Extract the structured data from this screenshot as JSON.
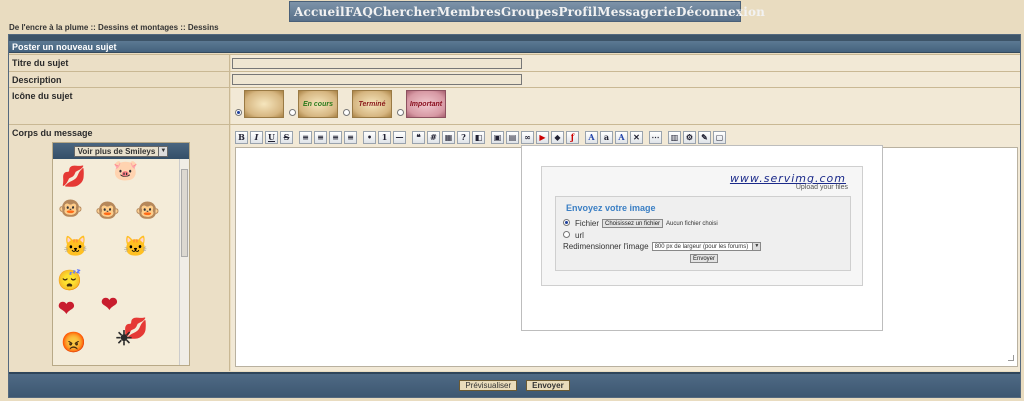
{
  "nav": [
    "Accueil",
    "FAQ",
    "Chercher",
    "Membres",
    "Groupes",
    "Profil",
    "Messagerie",
    "Déconnexion"
  ],
  "breadcrumb": "De l'encre à la plume  :: Dessins et montages :: Dessins",
  "form": {
    "header": "Poster un nouveau sujet",
    "title_label": "Titre du sujet",
    "description_label": "Description",
    "icon_label": "Icône du sujet",
    "body_label": "Corps du message"
  },
  "topic_icons": [
    {
      "label": "",
      "selected": true,
      "style": "parchment"
    },
    {
      "label": "En cours",
      "selected": false,
      "style": "parchment",
      "color": "#2b7a1c"
    },
    {
      "label": "Terminé",
      "selected": false,
      "style": "parchment",
      "color": "#8a1b1b"
    },
    {
      "label": "Important",
      "selected": false,
      "style": "pink",
      "color": "#8a1020"
    }
  ],
  "smileys": {
    "select_label": "Voir plus de Smileys",
    "items": [
      "lips-icon",
      "pink-creature-icon",
      "monkey-heart-icon",
      "monkey-icon",
      "monkey-laugh-icon",
      "cat-heart-icon",
      "cat-icon",
      "sleeping-icon",
      "red-heart-icon",
      "heart-icon",
      "lips-small-icon",
      "red-face-icon",
      "sun-icon"
    ]
  },
  "toolbar": {
    "bold": "B",
    "italic": "I",
    "underline": "U",
    "strike": "S"
  },
  "upload": {
    "logo": "www.servimg.com",
    "tagline": "Upload your files",
    "title": "Envoyez votre image",
    "option_file": "Fichier",
    "choose_button": "Choisissez un fichier",
    "no_file": "Aucun fichier choisi",
    "option_url": "url",
    "resize_label": "Redimensionner l'image",
    "resize_value": "800 px de largeur (pour les forums)",
    "send_button": "Envoyer"
  },
  "actions": {
    "preview": "Prévisualiser",
    "send": "Envoyer"
  }
}
